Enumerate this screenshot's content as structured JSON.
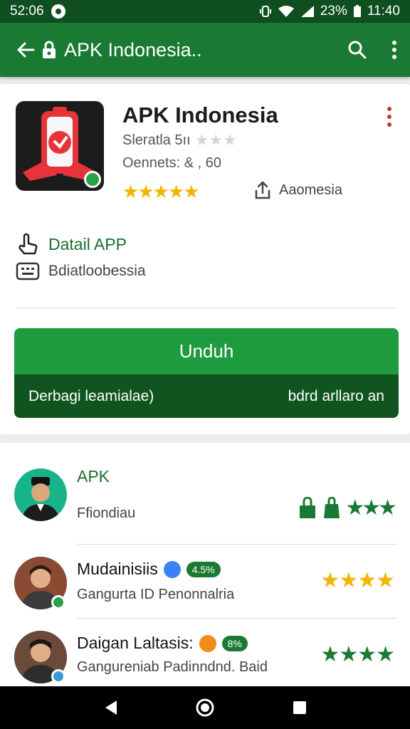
{
  "status_bar": {
    "time_left": "52:06",
    "battery": "23%",
    "time_right": "11:40"
  },
  "app_bar": {
    "title": "APK Indonesia.."
  },
  "app": {
    "name": "APK Indonesia",
    "meta_line1": "Sleratla 5ıı",
    "meta_line2": "Oennets: & , 60",
    "stars": "★★★★★",
    "share_label": "Aaomesia"
  },
  "details": {
    "detail_label": "Datail APP",
    "category_label": "Bdiatloobessia"
  },
  "download": {
    "button_label": "Unduh",
    "left_caption": "Derbagi leamialae)",
    "right_caption": "bdrd arllaro an"
  },
  "list": {
    "items": [
      {
        "name": "APK",
        "subtitle": "Ffiondiau",
        "stars": "★★★"
      },
      {
        "name": "Mudainisiis",
        "pill": "4.5%",
        "subtitle": "Gangurta ID Penonnalria",
        "stars": "★★★★"
      },
      {
        "name": "Daigan Laltasis:",
        "pill": "8%",
        "subtitle": "Gangureniab Padinndnd. Baid",
        "stars": "★★★★"
      }
    ]
  },
  "colors": {
    "primary": "#1a7a34",
    "dark": "#10551f",
    "star": "#f4b400"
  }
}
